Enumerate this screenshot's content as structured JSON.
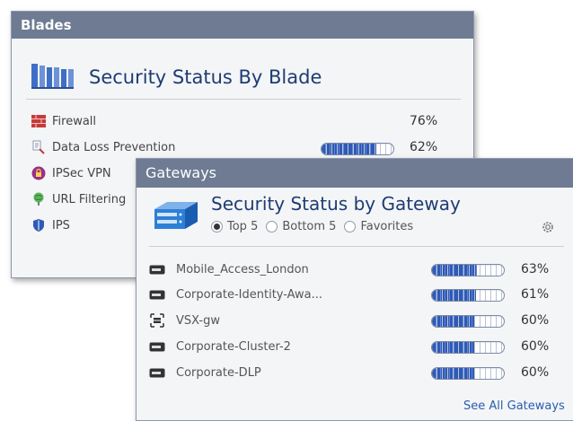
{
  "blades": {
    "header": "Blades",
    "title": "Security Status By Blade",
    "items": [
      {
        "label": "Firewall",
        "progress_pct": 76,
        "percent": "76%",
        "icon": "firewall-icon",
        "color": "#c73a3a"
      },
      {
        "label": "Data Loss Prevention",
        "progress_pct": 62,
        "percent": "62%",
        "icon": "dlp-icon",
        "color": "#8a98ad"
      },
      {
        "label": "IPSec VPN",
        "icon": "lock-icon",
        "color": "#9b2e8c"
      },
      {
        "label": "URL Filtering",
        "icon": "globe-pin-icon",
        "color": "#4aa04a"
      },
      {
        "label": "IPS",
        "icon": "shield-icon",
        "color": "#2f5ab5"
      }
    ]
  },
  "gateways": {
    "header": "Gateways",
    "title": "Security Status by Gateway",
    "filters": [
      {
        "label": "Top 5",
        "selected": true
      },
      {
        "label": "Bottom 5",
        "selected": false
      },
      {
        "label": "Favorites",
        "selected": false
      }
    ],
    "items": [
      {
        "label": "Mobile_Access_London",
        "progress_pct": 63,
        "percent": "63%",
        "icon": "gateway-icon"
      },
      {
        "label": "Corporate-Identity-Awa...",
        "progress_pct": 61,
        "percent": "61%",
        "icon": "gateway-icon"
      },
      {
        "label": "VSX-gw",
        "progress_pct": 60,
        "percent": "60%",
        "icon": "vsx-icon"
      },
      {
        "label": "Corporate-Cluster-2",
        "progress_pct": 60,
        "percent": "60%",
        "icon": "gateway-icon"
      },
      {
        "label": "Corporate-DLP",
        "progress_pct": 60,
        "percent": "60%",
        "icon": "gateway-icon"
      }
    ],
    "see_all": "See All Gateways"
  }
}
